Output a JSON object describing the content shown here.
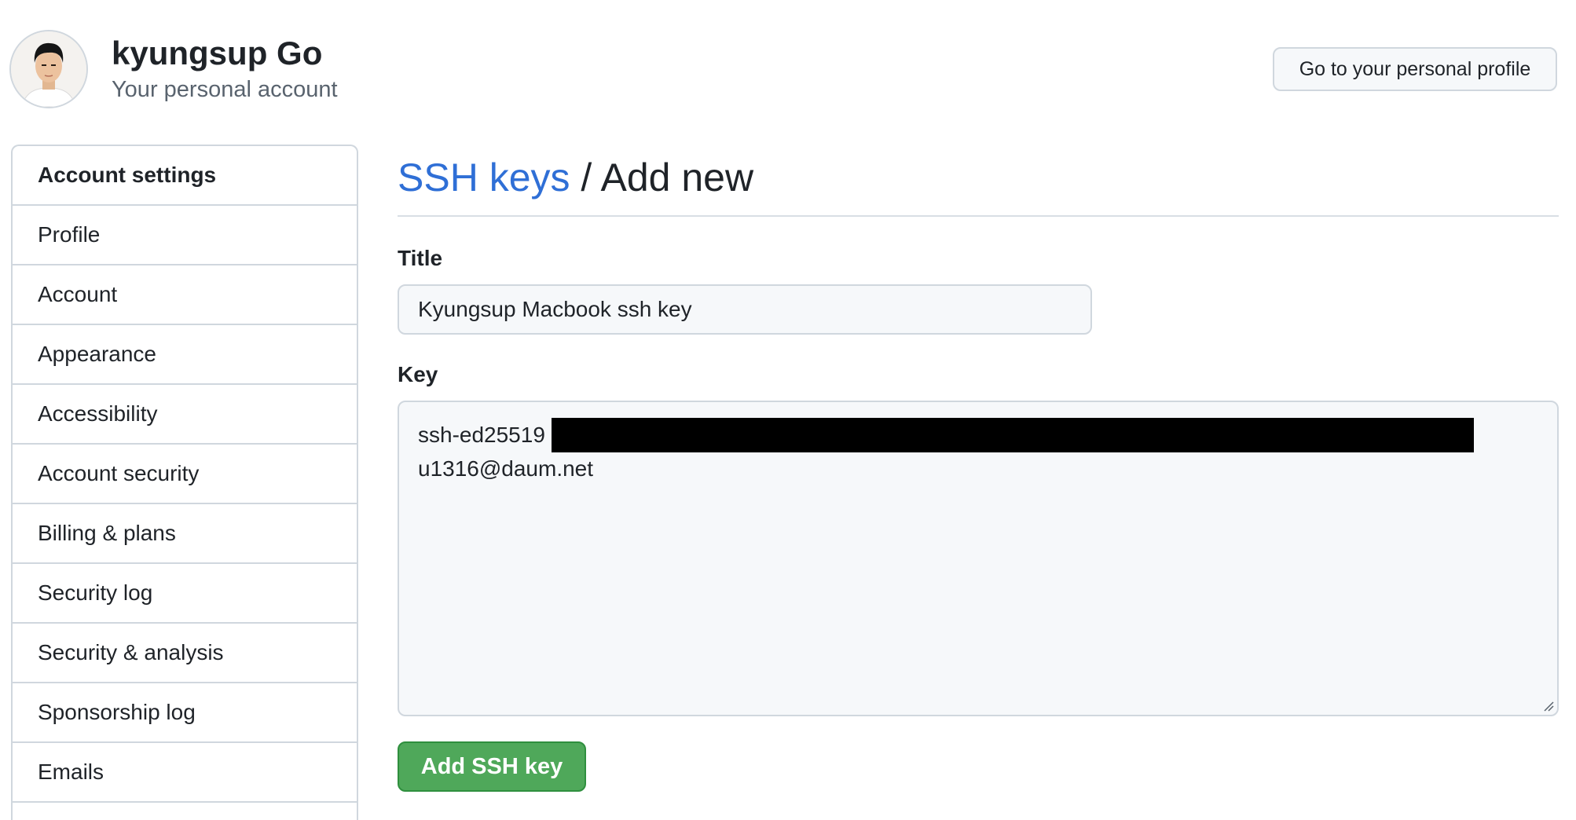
{
  "header": {
    "account_name": "kyungsup Go",
    "account_subtitle": "Your personal account",
    "profile_button_label": "Go to your personal profile"
  },
  "sidebar": {
    "heading": "Account settings",
    "items": [
      {
        "label": "Profile"
      },
      {
        "label": "Account"
      },
      {
        "label": "Appearance"
      },
      {
        "label": "Accessibility"
      },
      {
        "label": "Account security"
      },
      {
        "label": "Billing & plans"
      },
      {
        "label": "Security log"
      },
      {
        "label": "Security & analysis"
      },
      {
        "label": "Sponsorship log"
      },
      {
        "label": "Emails"
      }
    ]
  },
  "main": {
    "breadcrumb_link": "SSH keys",
    "breadcrumb_separator": "/",
    "breadcrumb_current": "Add new",
    "title_label": "Title",
    "title_value": "Kyungsup Macbook ssh key",
    "key_label": "Key",
    "key_prefix": "ssh-ed25519",
    "key_email": "u1316@daum.net",
    "submit_label": "Add SSH key"
  },
  "colors": {
    "link": "#2f6fd6",
    "primary_button": "#4fa85a",
    "border": "#d0d7de",
    "input_bg": "#f6f8fa",
    "redaction": "#000000"
  },
  "icons": {
    "avatar": "user-photo",
    "resize": "textarea-resize-grip"
  }
}
